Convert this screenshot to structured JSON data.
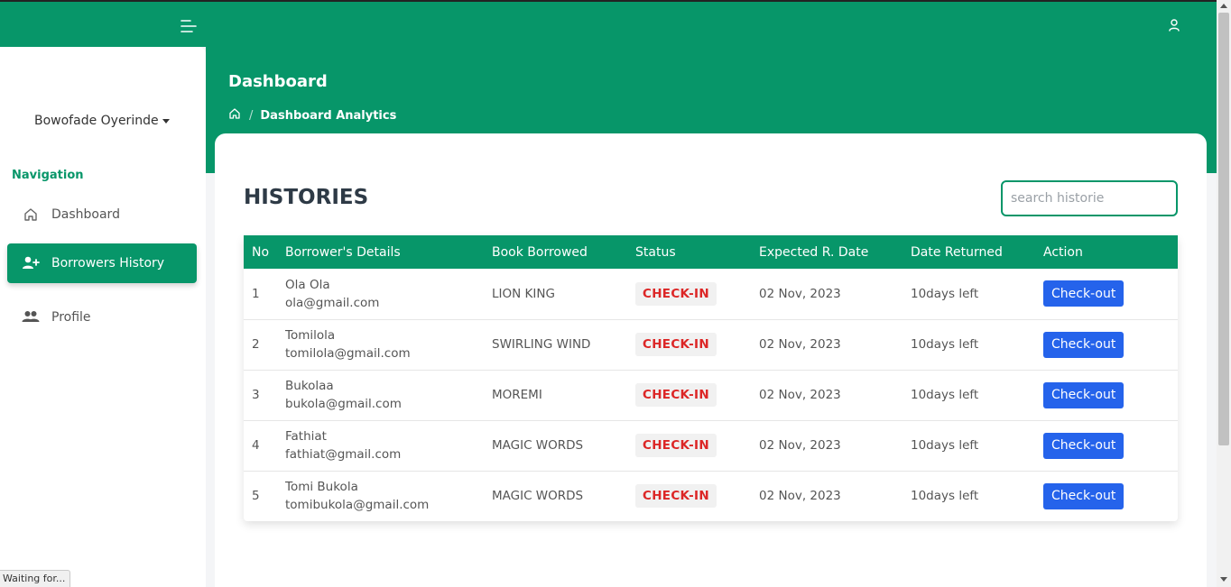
{
  "topbar": {
    "bg_color": "#079669",
    "menu_icon": "menu-toggle-icon",
    "user_icon": "user-icon"
  },
  "header": {
    "title": "Dashboard",
    "breadcrumb": {
      "home_icon": "home-icon",
      "separator": "/",
      "current": "Dashboard Analytics"
    }
  },
  "sidebar": {
    "user_name": "Bowofade Oyerinde",
    "nav_heading": "Navigation",
    "items": [
      {
        "label": "Dashboard",
        "icon": "home-icon",
        "active": false
      },
      {
        "label": "Borrowers History",
        "icon": "user-add-icon",
        "active": true
      },
      {
        "label": "Profile",
        "icon": "users-icon",
        "active": false
      }
    ]
  },
  "main": {
    "title": "HISTORIES",
    "search": {
      "placeholder": "search historie",
      "value": ""
    },
    "table": {
      "columns": [
        "No",
        "Borrower's Details",
        "Book Borrowed",
        "Status",
        "Expected R. Date",
        "Date Returned",
        "Action"
      ],
      "rows": [
        {
          "no": "1",
          "name": "Ola Ola",
          "email": "ola@gmail.com",
          "book": "LION KING",
          "status": "CHECK-IN",
          "expected": "02 Nov, 2023",
          "returned": "10days left",
          "action": "Check-out"
        },
        {
          "no": "2",
          "name": "Tomilola",
          "email": "tomilola@gmail.com",
          "book": "SWIRLING WIND",
          "status": "CHECK-IN",
          "expected": "02 Nov, 2023",
          "returned": "10days left",
          "action": "Check-out"
        },
        {
          "no": "3",
          "name": "Bukolaa",
          "email": "bukola@gmail.com",
          "book": "MOREMI",
          "status": "CHECK-IN",
          "expected": "02 Nov, 2023",
          "returned": "10days left",
          "action": "Check-out"
        },
        {
          "no": "4",
          "name": "Fathiat",
          "email": "fathiat@gmail.com",
          "book": "MAGIC WORDS",
          "status": "CHECK-IN",
          "expected": "02 Nov, 2023",
          "returned": "10days left",
          "action": "Check-out"
        },
        {
          "no": "5",
          "name": "Tomi Bukola",
          "email": "tomibukola@gmail.com",
          "book": "MAGIC WORDS",
          "status": "CHECK-IN",
          "expected": "02 Nov, 2023",
          "returned": "10days left",
          "action": "Check-out"
        }
      ]
    }
  },
  "browser_status": "Waiting for...",
  "colors": {
    "brand": "#079669",
    "status_text": "#dc2626",
    "action_button": "#2563eb"
  }
}
